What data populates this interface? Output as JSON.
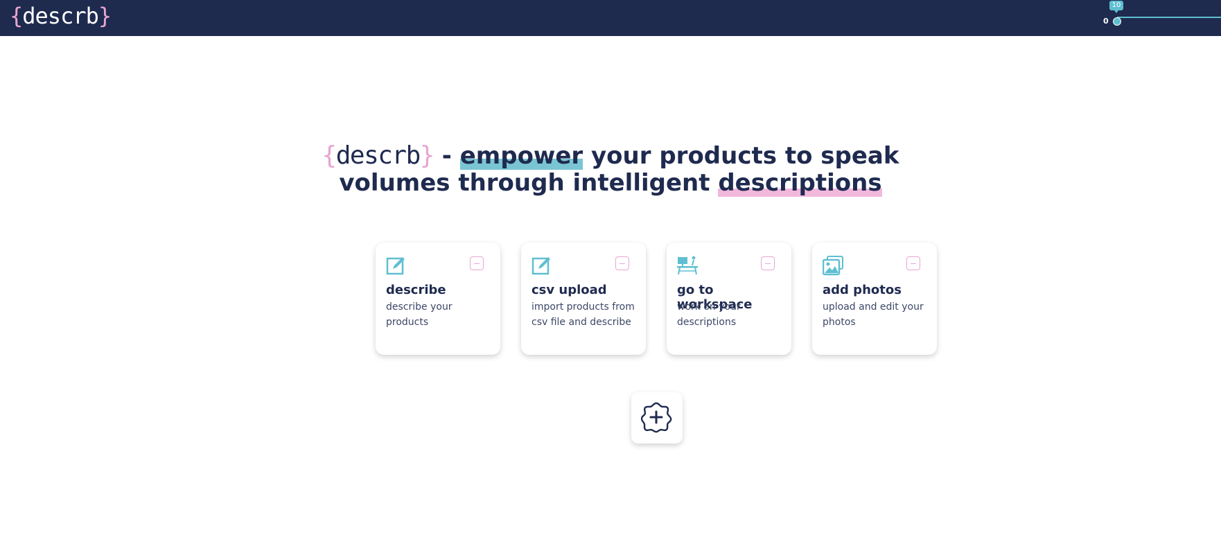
{
  "header": {
    "logo_open": "{",
    "logo_text": "descrb",
    "logo_close": "}",
    "slider": {
      "min_label": "0",
      "value_label": "10",
      "value": 10
    }
  },
  "hero": {
    "brand_open": "{",
    "brand_text": "descrb",
    "brand_close": "}",
    "separator": " - ",
    "highlight1": "empower",
    "middle": " your products to speak volumes through intelligent ",
    "highlight2": "descriptions"
  },
  "cards": [
    {
      "icon": "edit-icon",
      "title": "describe",
      "description": "describe your products"
    },
    {
      "icon": "edit-icon",
      "title": "csv upload",
      "description": "import products from csv file and describe"
    },
    {
      "icon": "desk-icon",
      "title": "go to workspace",
      "description": "work on your descriptions"
    },
    {
      "icon": "photos-icon",
      "title": "add photos",
      "description": "upload and edit your photos"
    }
  ],
  "add_button": {
    "icon": "add-icon"
  },
  "colors": {
    "navy": "#1f2a4f",
    "teal": "#5fbfd0",
    "pink": "#e8a6d0"
  }
}
